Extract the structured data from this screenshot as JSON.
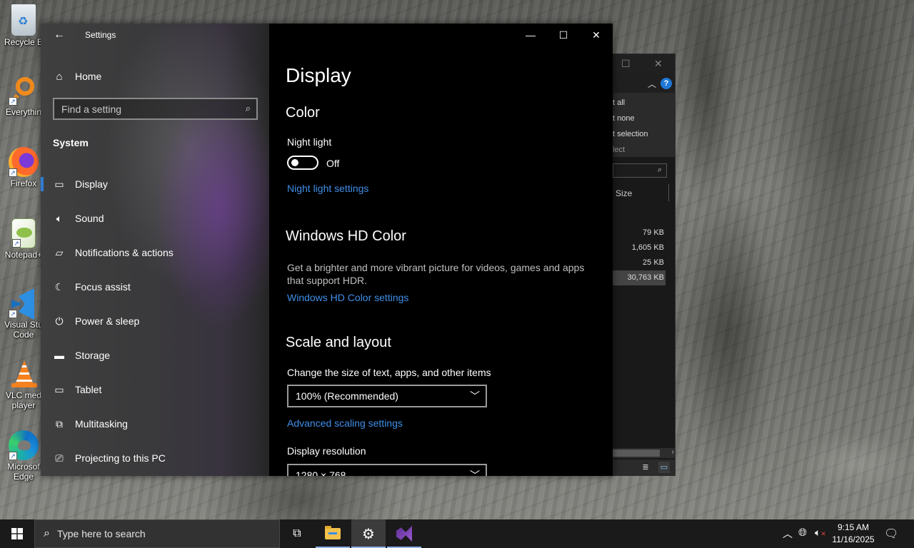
{
  "desktop": {
    "icons": [
      {
        "label": "Recycle B",
        "icon": "recycle-bin-icon"
      },
      {
        "label": "Everythin",
        "icon": "everything-search-icon"
      },
      {
        "label": "Firefox",
        "icon": "firefox-icon"
      },
      {
        "label": "Notepad+",
        "icon": "notepad-plus-plus-icon"
      },
      {
        "label": "Visual Stu\nCode",
        "icon": "vscode-icon"
      },
      {
        "label": "VLC med\nplayer",
        "icon": "vlc-icon"
      },
      {
        "label": "Microsof\nEdge",
        "icon": "edge-icon"
      }
    ]
  },
  "explorer": {
    "ribbon_items": [
      "t all",
      "t none",
      "t selection",
      "lect"
    ],
    "column_header": "Size",
    "file_sizes": [
      "79 KB",
      "1,605 KB",
      "25 KB",
      "30,763 KB"
    ],
    "selected_index": 3
  },
  "settings": {
    "app_title": "Settings",
    "home_label": "Home",
    "search_placeholder": "Find a setting",
    "section": "System",
    "nav_items": [
      {
        "label": "Display",
        "icon": "monitor-icon",
        "active": true
      },
      {
        "label": "Sound",
        "icon": "speaker-icon"
      },
      {
        "label": "Notifications & actions",
        "icon": "notification-icon"
      },
      {
        "label": "Focus assist",
        "icon": "moon-icon"
      },
      {
        "label": "Power & sleep",
        "icon": "power-icon"
      },
      {
        "label": "Storage",
        "icon": "storage-icon"
      },
      {
        "label": "Tablet",
        "icon": "tablet-icon"
      },
      {
        "label": "Multitasking",
        "icon": "multitasking-icon"
      },
      {
        "label": "Projecting to this PC",
        "icon": "projecting-icon"
      }
    ],
    "page": {
      "title": "Display",
      "color_heading": "Color",
      "night_light_label": "Night light",
      "night_light_state": "Off",
      "night_light_link": "Night light settings",
      "hd_heading": "Windows HD Color",
      "hd_description": "Get a brighter and more vibrant picture for videos, games and apps that support HDR.",
      "hd_link": "Windows HD Color settings",
      "scale_heading": "Scale and layout",
      "scale_label": "Change the size of text, apps, and other items",
      "scale_value": "100% (Recommended)",
      "advanced_link": "Advanced scaling settings",
      "resolution_label": "Display resolution",
      "resolution_value": "1280 × 768"
    }
  },
  "taskbar": {
    "search_placeholder": "Type here to search",
    "time": "9:15 AM",
    "date": "11/16/2025"
  }
}
